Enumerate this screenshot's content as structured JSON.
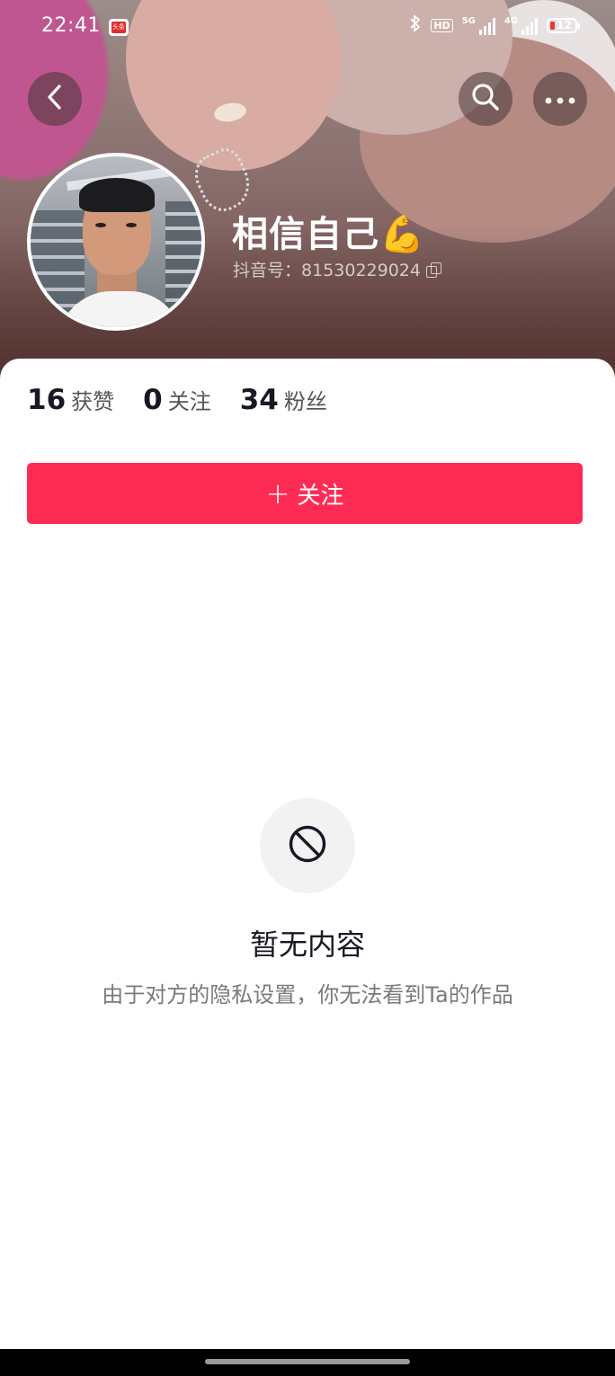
{
  "status_bar": {
    "time": "22:41",
    "app_badge": "头条",
    "hd": "HD",
    "net1": "5G",
    "net2": "4G",
    "battery": "12"
  },
  "profile": {
    "display_name": "相信自己💪",
    "douyin_id": "抖音号：81530229024"
  },
  "stats": [
    {
      "value": "16",
      "label": "获赞"
    },
    {
      "value": "0",
      "label": "关注"
    },
    {
      "value": "34",
      "label": "粉丝"
    }
  ],
  "follow_button": {
    "label": "关注"
  },
  "empty_state": {
    "title": "暂无内容",
    "description": "由于对方的隐私设置，你无法看到Ta的作品"
  },
  "colors": {
    "accent": "#fe2c55",
    "text_primary": "#161823",
    "text_secondary": "#7a7a7a"
  },
  "icons": [
    "back-arrow-icon",
    "search-icon",
    "more-dots-icon",
    "copy-icon",
    "prohibited-icon",
    "plus-icon"
  ]
}
